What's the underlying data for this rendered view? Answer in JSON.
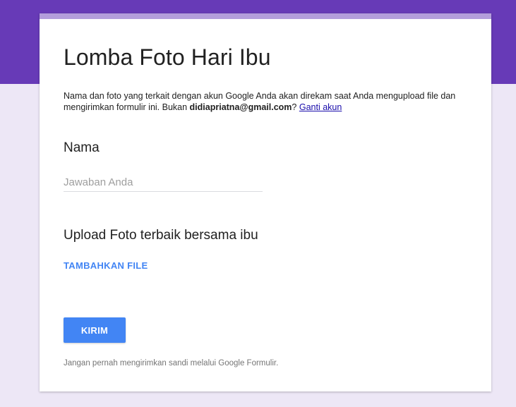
{
  "form": {
    "title": "Lomba Foto Hari Ibu",
    "notice": {
      "text_before": "Nama dan foto yang terkait dengan akun Google Anda akan direkam saat Anda mengupload file dan mengirimkan formulir ini. Bukan ",
      "email": "didiapriatna@gmail.com",
      "text_after": "? ",
      "switch_account_label": "Ganti akun"
    },
    "questions": [
      {
        "title": "Nama",
        "placeholder": "Jawaban Anda",
        "value": ""
      },
      {
        "title": "Upload Foto terbaik bersama ibu",
        "action_label": "TAMBAHKAN FILE"
      }
    ],
    "submit_label": "KIRIM",
    "footer_note": "Jangan pernah mengirimkan sandi melalui Google Formulir."
  },
  "colors": {
    "header": "#673ab7",
    "background": "#ede7f6",
    "card_accent": "#b39ddb",
    "primary_button": "#4285f4",
    "link": "#1a0dab"
  }
}
